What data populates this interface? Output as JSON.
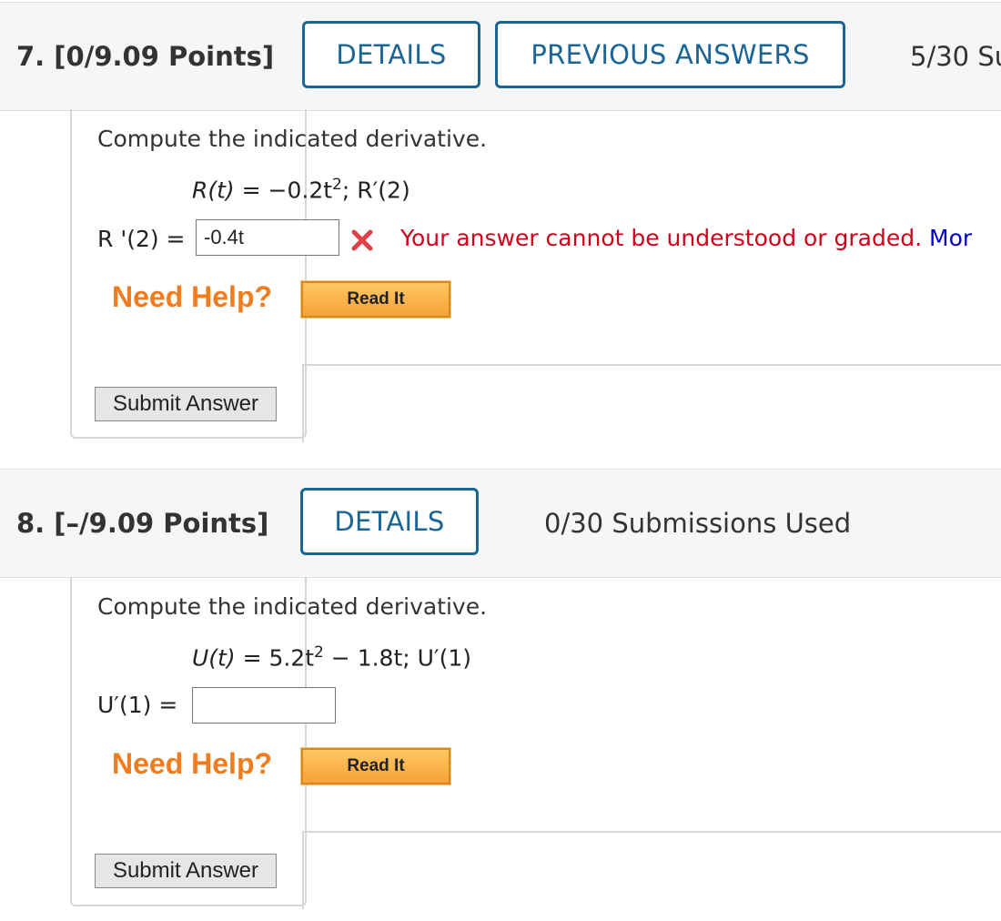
{
  "questions": [
    {
      "title": "7. [0/9.09 Points]",
      "details_label": "DETAILS",
      "previous_answers_label": "PREVIOUS ANSWERS",
      "submissions": "5/30 Su",
      "prompt": "Compute the indicated derivative.",
      "function_lhs": "R(t)",
      "function_rhs_pre": "= −0.2t",
      "function_exp": "2",
      "function_rhs_post": "; R′(2)",
      "answer_label": "R '(2)  =",
      "answer_value": "-0.4t",
      "error_message": "Your answer cannot be understood or graded.",
      "more_link": "Mor",
      "need_help": "Need Help?",
      "read_it": "Read It",
      "submit": "Submit Answer"
    },
    {
      "title": "8. [–/9.09 Points]",
      "details_label": "DETAILS",
      "submissions": "0/30 Submissions Used",
      "prompt": "Compute the indicated derivative.",
      "function_lhs": "U(t)",
      "function_rhs_pre": "= 5.2t",
      "function_exp": "2",
      "function_rhs_post": " − 1.8t; U′(1)",
      "answer_label": "U′(1)  =",
      "answer_value": "",
      "need_help": "Need Help?",
      "read_it": "Read It",
      "submit": "Submit Answer"
    }
  ],
  "colors": {
    "accent": "#1a6496",
    "error": "#d0021b",
    "help": "#f07c1e"
  }
}
